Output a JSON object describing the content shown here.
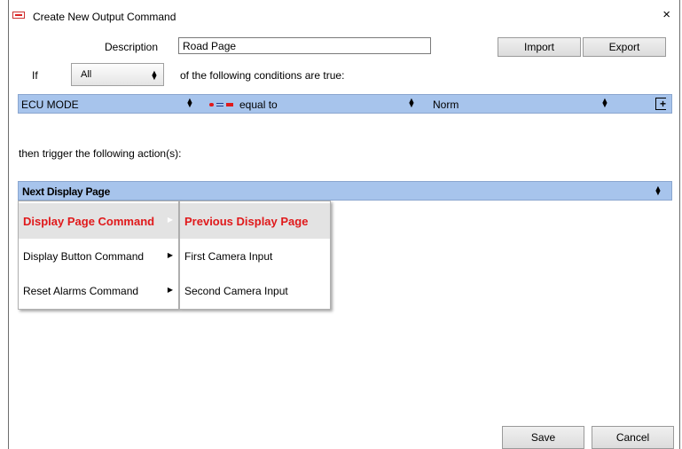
{
  "window": {
    "title": "Create New Output Command",
    "close_label": "×",
    "app_icon": "app-logo-icon"
  },
  "form": {
    "description_label": "Description",
    "description_value": "Road Page",
    "import_label": "Import",
    "export_label": "Export",
    "if_label": "If",
    "match_value": "All",
    "conditions_text": "of the following conditions are true:"
  },
  "condition": {
    "channel": "ECU MODE",
    "operator": "equal to",
    "value": "Norm",
    "operator_colors": [
      "#e0191b",
      "#1f3f8f",
      "#e0191b"
    ]
  },
  "actions": {
    "intro": "then trigger the following action(s):",
    "selected_action": "Next Display Page"
  },
  "menu": {
    "items": [
      {
        "label": "Display Page Command",
        "selected": true
      },
      {
        "label": "Display Button Command",
        "selected": false
      },
      {
        "label": "Reset Alarms Command",
        "selected": false
      }
    ],
    "submenu_items": [
      {
        "label": "Previous Display Page",
        "selected": true
      },
      {
        "label": "First Camera Input",
        "selected": false
      },
      {
        "label": "Second Camera Input",
        "selected": false
      }
    ]
  },
  "footer": {
    "save_label": "Save",
    "cancel_label": "Cancel"
  },
  "colors": {
    "accent_bar": "#a7c4ec",
    "highlight_text": "#e0191b"
  }
}
